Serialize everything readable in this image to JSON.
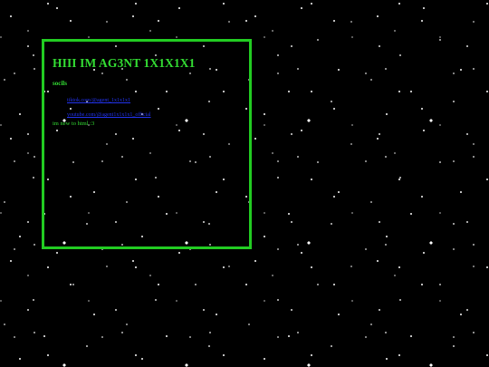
{
  "page": {
    "heading": "HIII IM AG3NT 1X1X1X1",
    "socials_heading": "socils",
    "links": [
      {
        "label": "tiktok.com/@agent_1x1x1x1"
      },
      {
        "label": "youtube.com/@agent1x1x1x1_official"
      }
    ],
    "note": "im new to html :3"
  },
  "colors": {
    "background": "#000000",
    "panel_border": "#22cc22",
    "heading_text": "#33dd33",
    "link_text": "#2233ee"
  }
}
